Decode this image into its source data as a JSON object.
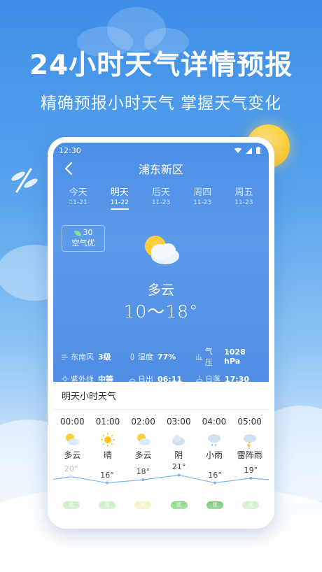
{
  "promo": {
    "headline": "24小时天气详情预报",
    "subheadline": "精确预报小时天气  掌握天气变化"
  },
  "status": {
    "time": "12:30"
  },
  "nav": {
    "city": "浦东新区"
  },
  "day_tabs": [
    {
      "label": "今天",
      "date": "11-21",
      "active": false
    },
    {
      "label": "明天",
      "date": "11-22",
      "active": true
    },
    {
      "label": "后天",
      "date": "11-23",
      "active": false
    },
    {
      "label": "周四",
      "date": "11-23",
      "active": false
    },
    {
      "label": "周五",
      "date": "11-23",
      "active": false
    }
  ],
  "air": {
    "value": "30",
    "label": "空气优"
  },
  "current": {
    "condition": "多云",
    "temp_range": "10～18°"
  },
  "details": {
    "wind_label": "东南风",
    "wind_value": "3级",
    "humidity_label": "湿度",
    "humidity_value": "77%",
    "pressure_label": "气压",
    "pressure_value": "1028 hPa",
    "uv_label": "紫外线",
    "uv_value": "中等",
    "sunrise_label": "日出",
    "sunrise_value": "06:11",
    "sunset_label": "日落",
    "sunset_value": "17:30"
  },
  "hourly": {
    "title": "明天小时天气",
    "items": [
      {
        "time": "00:00",
        "icon": "partly-cloudy-icon",
        "condition": "多云",
        "temp": 20,
        "temp_label": "20°",
        "aqi_color": "#bfe8b6",
        "aqi": "优"
      },
      {
        "time": "01:00",
        "icon": "sunny-icon",
        "condition": "晴",
        "temp": 16,
        "temp_label": "16°",
        "aqi_color": "#bfe8b6",
        "aqi": "优"
      },
      {
        "time": "02:00",
        "icon": "partly-cloudy-icon",
        "condition": "多云",
        "temp": 18,
        "temp_label": "18°",
        "aqi_color": "#f6efb0",
        "aqi": "良"
      },
      {
        "time": "03:00",
        "icon": "overcast-icon",
        "condition": "阴",
        "temp": 21,
        "temp_label": "21°",
        "aqi_color": "#6fcf6a",
        "aqi": "优"
      },
      {
        "time": "04:00",
        "icon": "light-rain-icon",
        "condition": "小雨",
        "temp": 16,
        "temp_label": "16°",
        "aqi_color": "#5cbf58",
        "aqi": "优"
      },
      {
        "time": "05:00",
        "icon": "thunder-shower-icon",
        "condition": "雷阵雨",
        "temp": 19,
        "temp_label": "19°",
        "aqi_color": "#c7ecbf",
        "aqi": "优"
      }
    ]
  },
  "colors": {
    "sky_blue": "#4b8fe6",
    "sun": "#ffd23f",
    "line": "#7ab6ef"
  }
}
